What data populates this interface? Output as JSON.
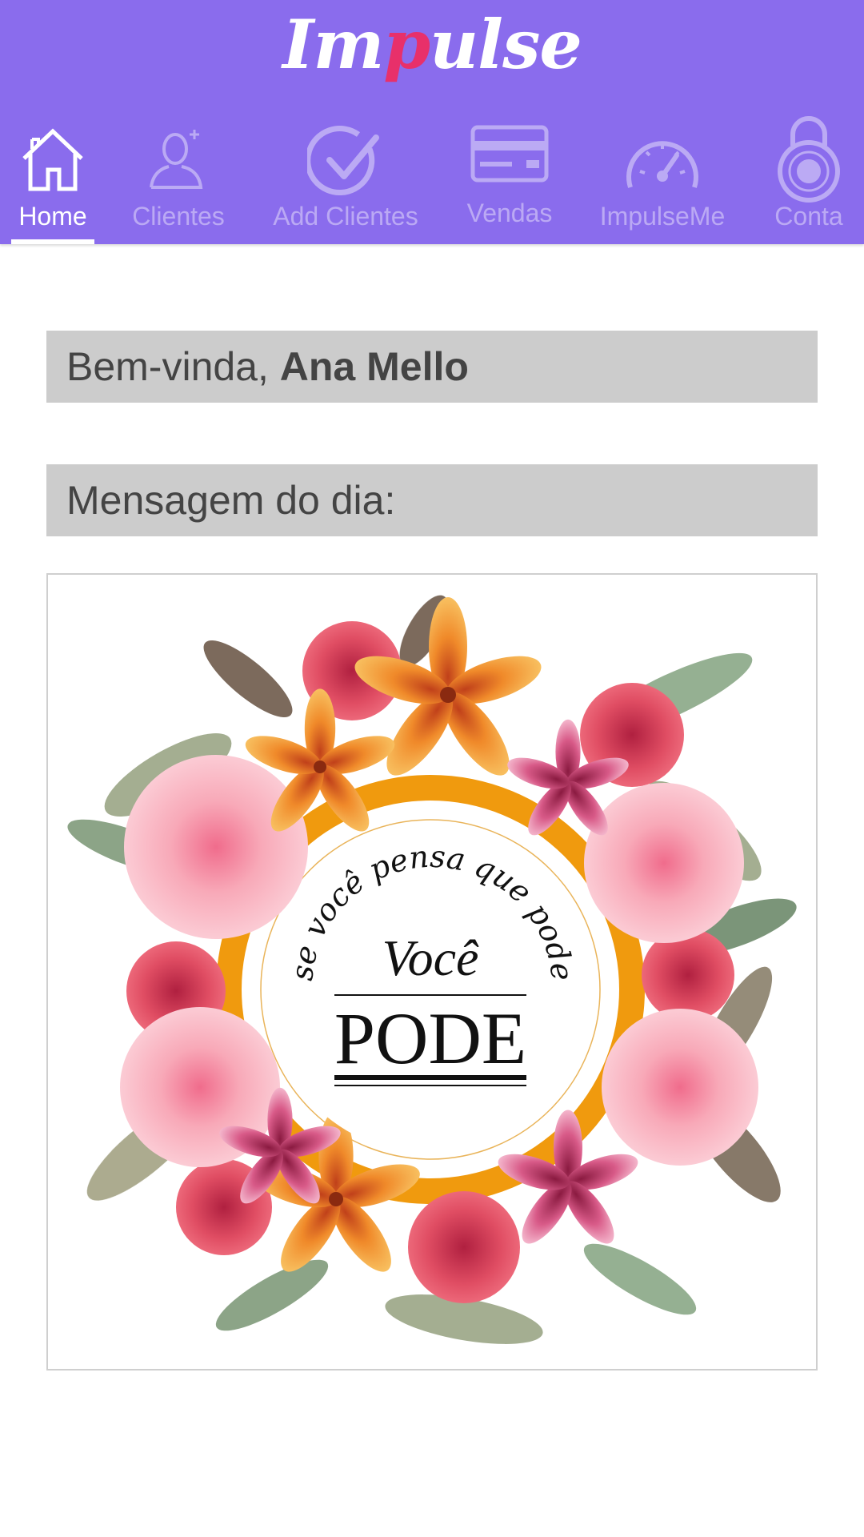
{
  "app": {
    "logo_left": "Im",
    "logo_accent": "p",
    "logo_right": "ulse"
  },
  "nav": {
    "tabs": [
      {
        "label": "Home",
        "icon": "home-icon",
        "active": true
      },
      {
        "label": "Clientes",
        "icon": "user-plus-icon",
        "active": false
      },
      {
        "label": "Add Clientes",
        "icon": "check-circle-icon",
        "active": false
      },
      {
        "label": "Vendas",
        "icon": "credit-card-icon",
        "active": false
      },
      {
        "label": "ImpulseMe",
        "icon": "speedometer-icon",
        "active": false
      },
      {
        "label": "Conta",
        "icon": "padlock-icon",
        "active": false
      }
    ]
  },
  "welcome": {
    "greeting": "Bem-vinda, ",
    "user_name": "Ana Mello"
  },
  "message": {
    "heading": "Mensagem do dia:",
    "arc_text": "se você pensa que pode",
    "line1": "Você",
    "line2": "PODE"
  },
  "colors": {
    "header_bg": "#8a6ced",
    "logo_accent": "#e8306a",
    "banner_bg": "#cccccc",
    "frame_orange": "#f09a0e"
  }
}
